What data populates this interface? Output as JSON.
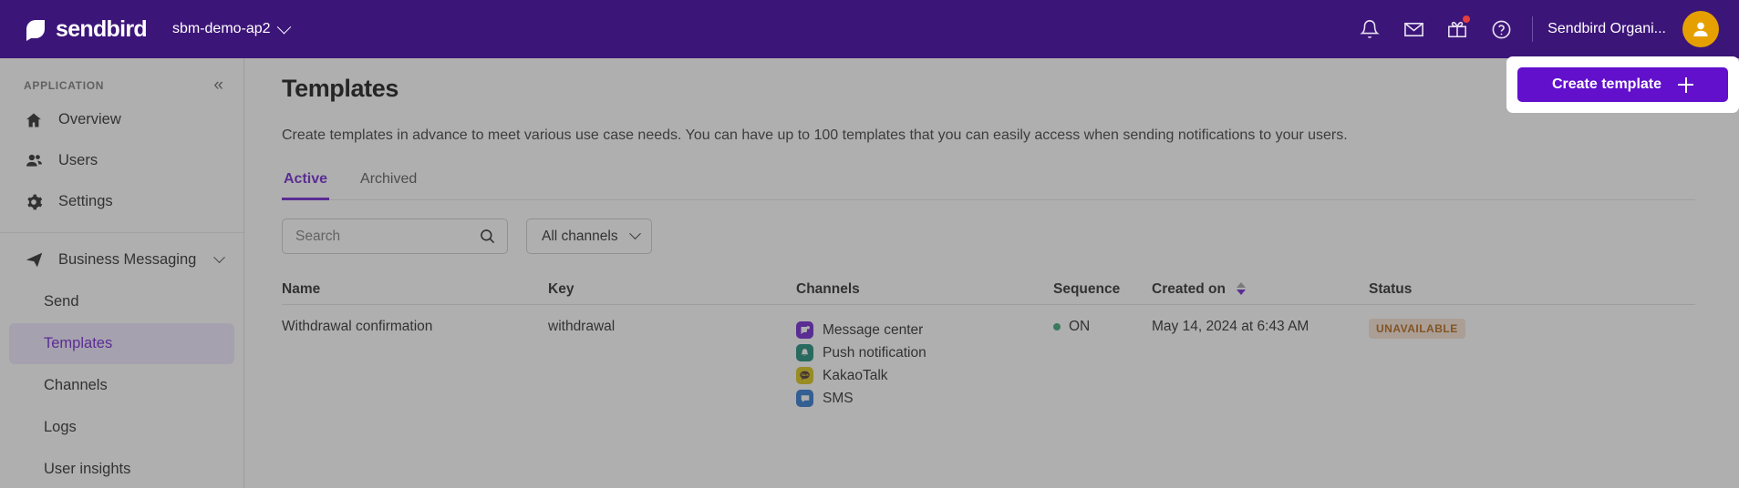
{
  "topnav": {
    "brand": "sendbird",
    "app_switcher": {
      "label": "sbm-demo-ap2"
    },
    "icons": [
      {
        "name": "bell-icon",
        "label": "Notifications"
      },
      {
        "name": "mail-icon",
        "label": "Messages"
      },
      {
        "name": "gift-icon",
        "label": "What's new",
        "badge": true
      },
      {
        "name": "help-icon",
        "label": "Help"
      }
    ],
    "org": "Sendbird Organi...",
    "avatar": "user-avatar"
  },
  "sidebar": {
    "section_label": "APPLICATION",
    "collapse_icon": "«",
    "items": [
      {
        "label": "Overview",
        "icon": "home-icon"
      },
      {
        "label": "Users",
        "icon": "users-icon"
      },
      {
        "label": "Settings",
        "icon": "gear-icon"
      }
    ],
    "group": {
      "label": "Business Messaging",
      "icon": "send-icon"
    },
    "sub_items": [
      {
        "label": "Send",
        "active": false
      },
      {
        "label": "Templates",
        "active": true
      },
      {
        "label": "Channels",
        "active": false
      },
      {
        "label": "Logs",
        "active": false
      },
      {
        "label": "User insights",
        "active": false
      }
    ]
  },
  "main": {
    "title": "Templates",
    "description": "Create templates in advance to meet various use case needs. You can have up to 100 templates that you can easily access when sending notifications to your users.",
    "create_button": {
      "label": "Create template",
      "icon": "plus-icon"
    },
    "tabs": [
      {
        "label": "Active",
        "active": true
      },
      {
        "label": "Archived",
        "active": false
      }
    ],
    "search": {
      "placeholder": "Search",
      "value": "",
      "icon": "search-icon"
    },
    "channel_filter": {
      "label": "All channels",
      "icon": "chevron-down-icon"
    },
    "table": {
      "columns": [
        {
          "label": "Name",
          "key": "name"
        },
        {
          "label": "Key",
          "key": "key"
        },
        {
          "label": "Channels",
          "key": "channels"
        },
        {
          "label": "Sequence",
          "key": "sequence"
        },
        {
          "label": "Created on",
          "key": "created_on",
          "sortable": true
        },
        {
          "label": "Status",
          "key": "status"
        }
      ],
      "rows": [
        {
          "name": "Withdrawal confirmation",
          "key": "withdrawal",
          "channels": [
            {
              "label": "Message center",
              "icon": "message-center-icon",
              "color": "#6210CC"
            },
            {
              "label": "Push notification",
              "icon": "push-notification-icon",
              "color": "#07806A"
            },
            {
              "label": "KakaoTalk",
              "icon": "kakaotalk-icon",
              "color": "#D4BE00"
            },
            {
              "label": "SMS",
              "icon": "sms-icon",
              "color": "#1A6BCB"
            }
          ],
          "sequence": "ON",
          "created_on": "May 14, 2024 at 6:43 AM",
          "status": "UNAVAILABLE"
        }
      ]
    }
  },
  "colors": {
    "brand_purple": "#3C1579",
    "accent_purple": "#6210CC",
    "status_bg": "#F5E0D0",
    "status_fg": "#AD5700",
    "on_green": "#259E68"
  }
}
